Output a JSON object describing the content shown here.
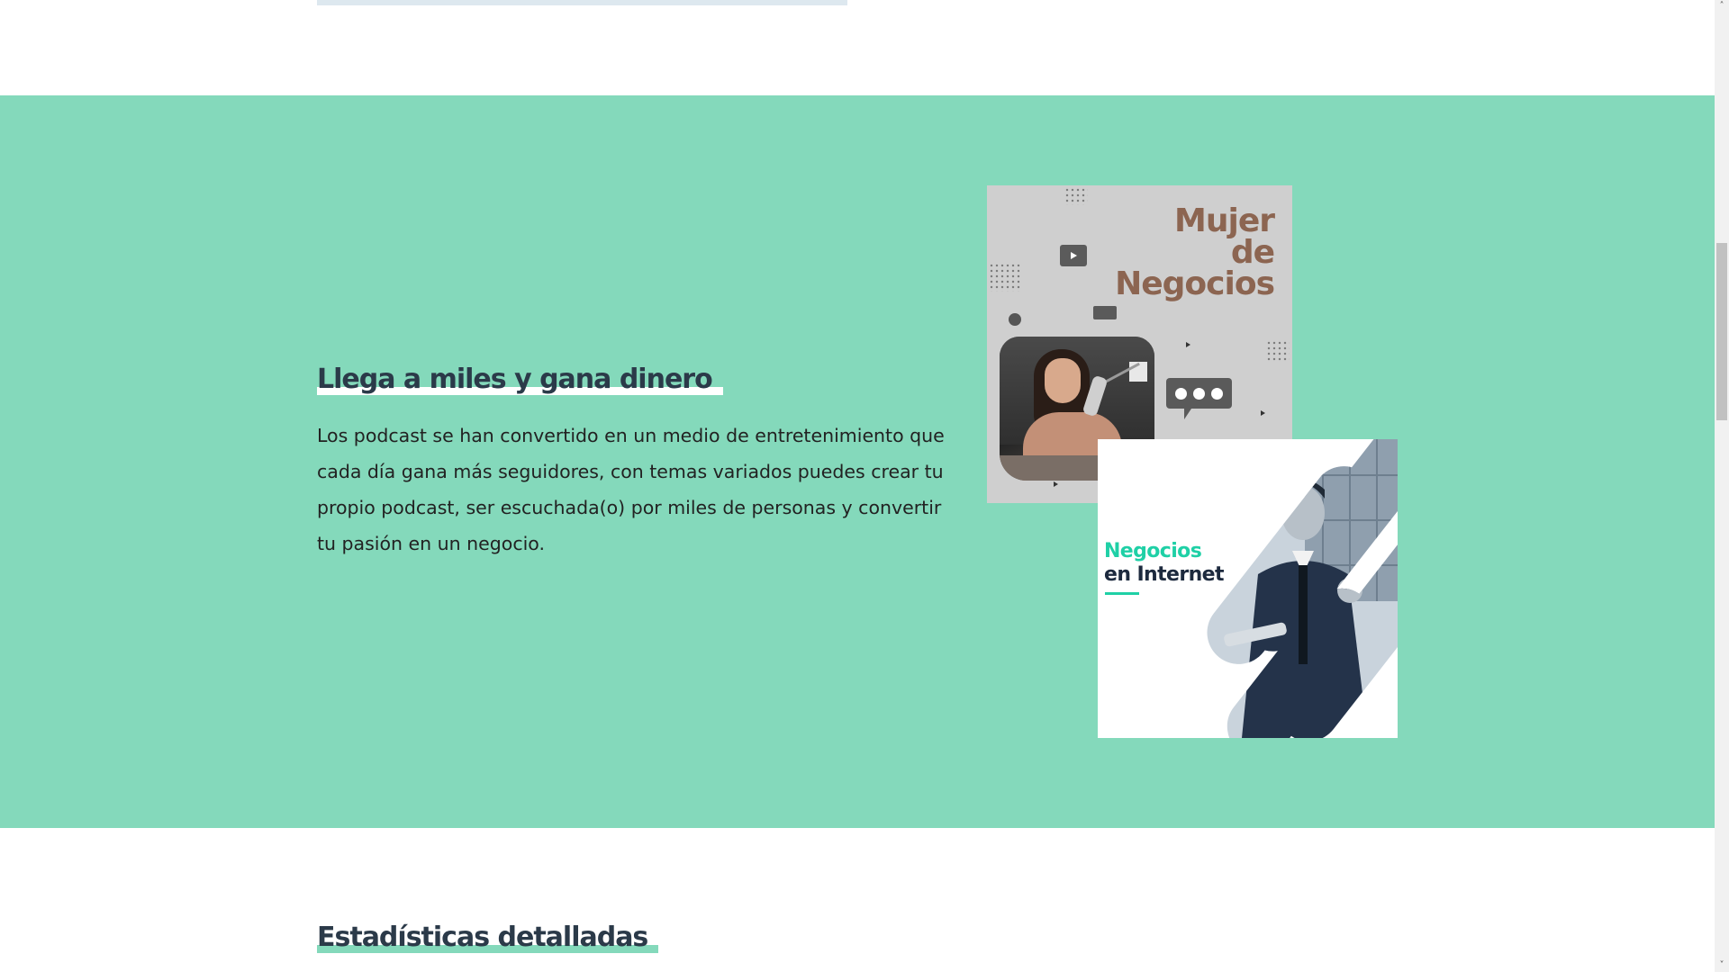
{
  "promo": {
    "heading": "Llega a miles y gana dinero",
    "body": "Los podcast se han convertido en un medio de entretenimiento que cada día gana más seguidores, con temas variados puedes crear tu propio podcast, ser escuchada(o) por miles de personas y convertir tu pasión en un negocio."
  },
  "card_one": {
    "title_lines": [
      "Mujer",
      "de",
      "Negocios"
    ]
  },
  "card_two": {
    "title_line1": "Negocios",
    "title_line2": "en Internet"
  },
  "stats": {
    "heading": "Estadísticas detalladas"
  },
  "scrollbar": {
    "up_arrow": "˄",
    "down_arrow": "˅",
    "position": 0.25
  },
  "colors": {
    "section_bg": "#84d9bb",
    "heading_text": "#2b3a49",
    "card_one_bg": "#cfcfcf",
    "card_one_title": "#8c6551",
    "card_two_accent": "#1fd0a6",
    "card_two_dark": "#1d2a3e"
  },
  "icons": [
    "play-icon",
    "chat-bubble-icon",
    "dotted-pattern-icon",
    "triangle-icon"
  ]
}
